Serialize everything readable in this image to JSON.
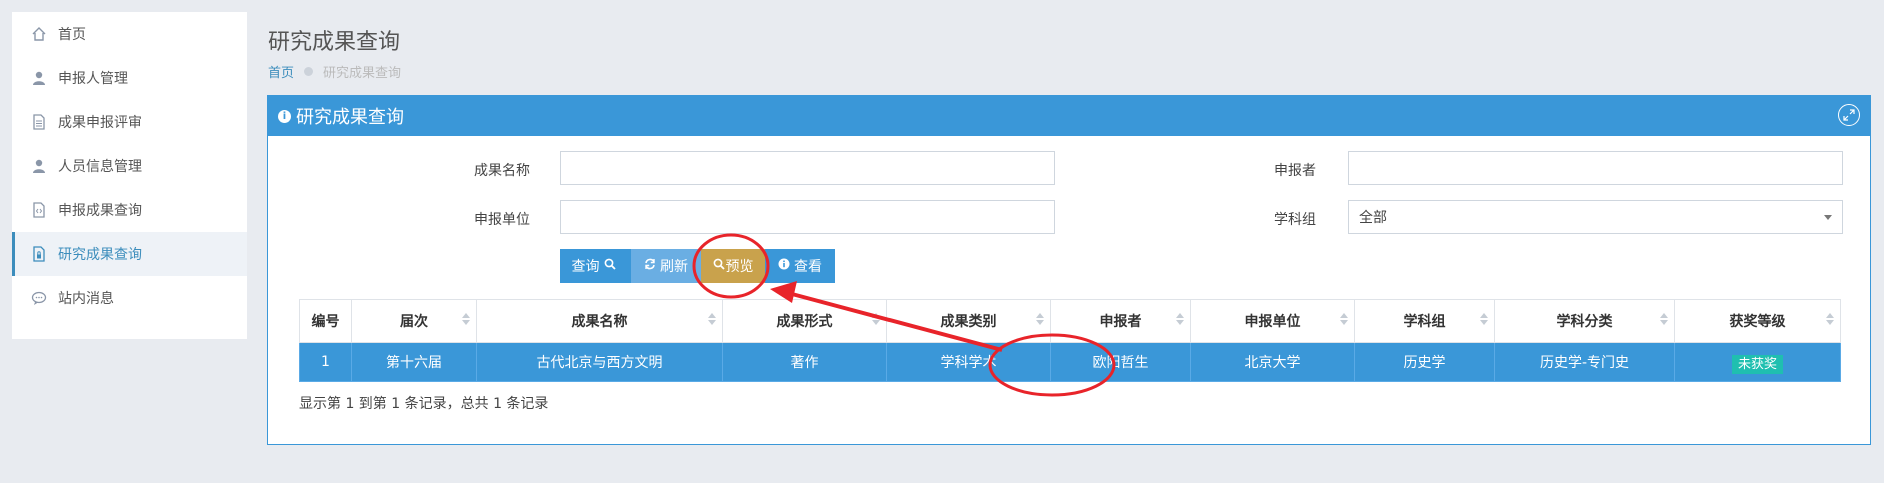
{
  "sidebar": {
    "items": [
      {
        "label": "首页",
        "icon": "home-icon"
      },
      {
        "label": "申报人管理",
        "icon": "user-icon"
      },
      {
        "label": "成果申报评审",
        "icon": "document-icon"
      },
      {
        "label": "人员信息管理",
        "icon": "user-icon"
      },
      {
        "label": "申报成果查询",
        "icon": "code-file-icon"
      },
      {
        "label": "研究成果查询",
        "icon": "file-lock-icon"
      },
      {
        "label": "站内消息",
        "icon": "chat-icon"
      }
    ],
    "active_index": 5
  },
  "header": {
    "title": "研究成果查询",
    "breadcrumb_home": "首页",
    "breadcrumb_current": "研究成果查询"
  },
  "panel": {
    "title": "研究成果查询"
  },
  "form": {
    "name_label": "成果名称",
    "name_value": "",
    "applicant_label": "申报者",
    "applicant_value": "",
    "unit_label": "申报单位",
    "unit_value": "",
    "group_label": "学科组",
    "group_value": "全部"
  },
  "buttons": {
    "query": "查询",
    "refresh": "刷新",
    "preview": "预览",
    "view": "查看"
  },
  "table": {
    "columns": [
      "编号",
      "届次",
      "成果名称",
      "成果形式",
      "成果类别",
      "申报者",
      "申报单位",
      "学科组",
      "学科分类",
      "获奖等级"
    ],
    "rows": [
      [
        "1",
        "第十六届",
        "古代北京与西方文明",
        "著作",
        "学科学术",
        "欧阳哲生",
        "北京大学",
        "历史学",
        "历史学-专门史",
        "未获奖"
      ]
    ]
  },
  "summary": "显示第 1 到第 1 条记录，总共 1 条记录",
  "colors": {
    "primary": "#3a97d8",
    "preview_button": "#c9a24c",
    "badge": "#1fbfb0",
    "annotation": "#e8242a"
  }
}
